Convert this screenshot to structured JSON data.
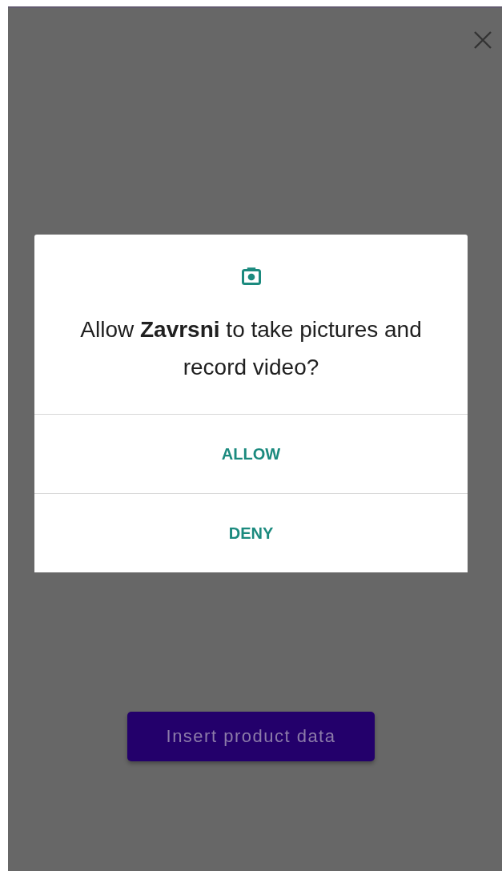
{
  "dialog": {
    "title": "Allow **Zavrsni** to take pictures and record video?",
    "buttons": [
      {
        "label": "ALLOW"
      },
      {
        "label": "DENY"
      }
    ]
  },
  "primary_button": {
    "label": "Insert product data"
  }
}
